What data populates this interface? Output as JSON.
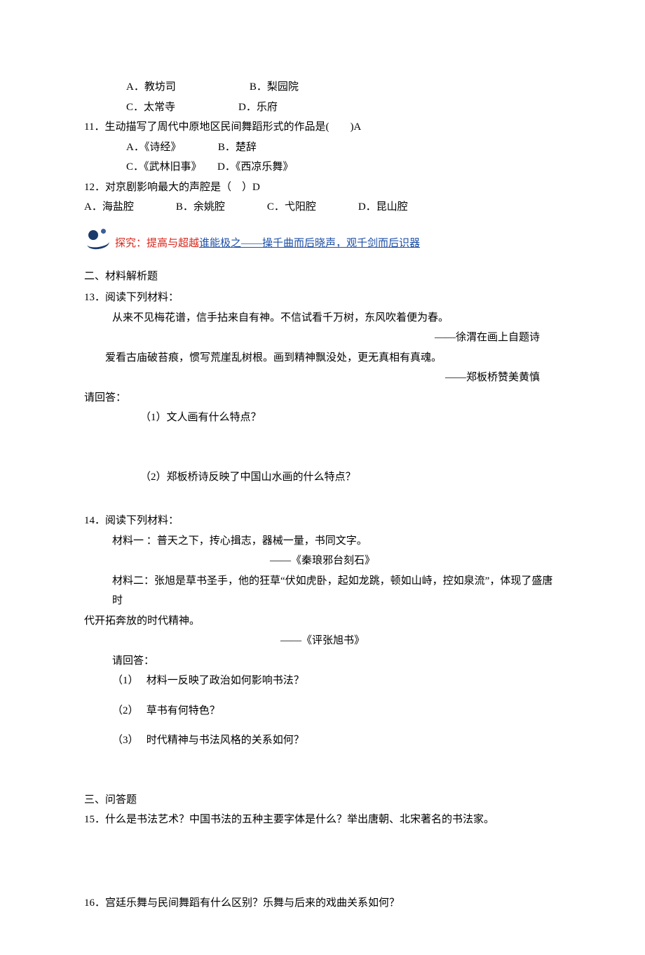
{
  "q10opts": {
    "a": "A．教坊司　　　　　　　B．梨园院",
    "c": "C．太常寺　　　　　　D．乐府"
  },
  "q11": {
    "stem": "11．生动描写了周代中原地区民间舞蹈形式的作品是(　　)A",
    "a": "A．《诗经》　　　　B．楚辞",
    "c": "C．《武林旧事》　　D．《西凉乐舞》"
  },
  "q12": {
    "stem": "12．对京剧影响最大的声腔是（　）D",
    "opts": "A．海盐腔　　　　B．余姚腔　　　　C．弋阳腔　　　　D．昆山腔"
  },
  "explore": {
    "red": "探究：提高与超越",
    "blue": "谁能极之——操千曲而后晓声，观千剑而后识器"
  },
  "sec2": "二、材料解析题",
  "q13": {
    "stem": "13．阅读下列材料：",
    "m1a": "从来不见梅花谱，信手拈来自有神。不信试看千万树，东风吹着便为春。",
    "m1src": "——徐渭在画上自题诗",
    "m1b": "爱看古庙破苔痕，惯写荒崖乱树根。画到精神飘没处，更无真相有真魂。",
    "m1bsrc": "——郑板桥赞美黄慎",
    "ans": "请回答：",
    "p1": "（1）文人画有什么特点？",
    "p2": "（2）郑板桥诗反映了中国山水画的什么特点？"
  },
  "q14": {
    "stem": "14．阅读下列材料：",
    "m1": "材料一 ：普天之下，抟心揖志，器械一量，书同文字。",
    "m1src": "——《秦琅邪台刻石》",
    "m2a": "材料二：张旭是草书圣手，他的狂草“伏如虎卧，起如龙跳，顿如山峙，控如泉流”，体现了盛唐时",
    "m2b": "代开拓奔放的时代精神。",
    "m2src": "——《评张旭书》",
    "ans": "请回答：",
    "p1": "（1）　 材料一反映了政治如何影响书法？",
    "p2": "（2）　 草书有何特色？",
    "p3": "（3）　 时代精神与书法风格的关系如何？"
  },
  "sec3": "三、问答题",
  "q15": "15．什么是书法艺术？中国书法的五种主要字体是什么？举出唐朝、北宋著名的书法家。",
  "q16": "16．宫廷乐舞与民间舞蹈有什么区别？乐舞与后来的戏曲关系如何？"
}
